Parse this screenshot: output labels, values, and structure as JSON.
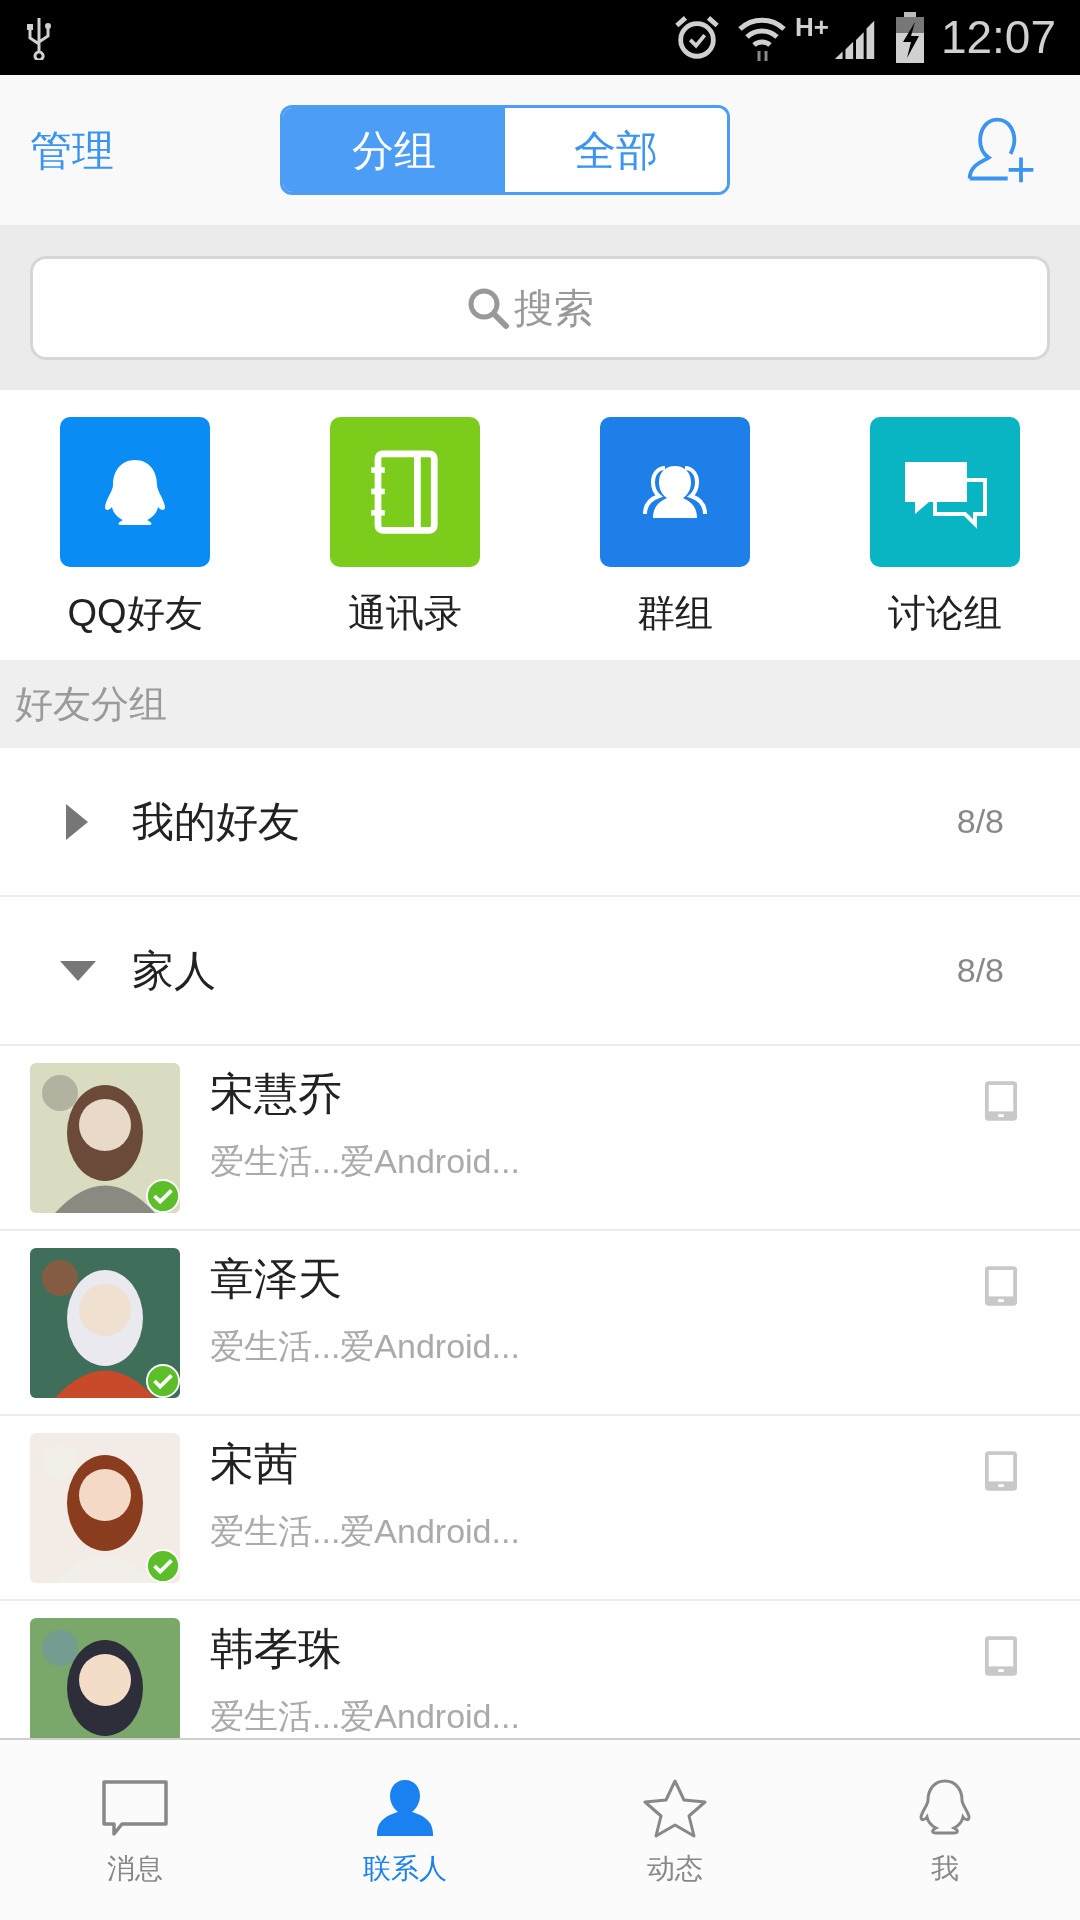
{
  "status_bar": {
    "time": "12:07",
    "network": "H+"
  },
  "header": {
    "manage": "管理",
    "tabs": [
      {
        "label": "分组",
        "selected": true
      },
      {
        "label": "全部",
        "selected": false
      }
    ]
  },
  "search": {
    "placeholder": "搜索"
  },
  "shortcuts": [
    {
      "label": "QQ好友",
      "kind": "penguin",
      "color": "#0a8cf5"
    },
    {
      "label": "通讯录",
      "kind": "notebook",
      "color": "#7ccd1b"
    },
    {
      "label": "群组",
      "kind": "group",
      "color": "#1f7fe8"
    },
    {
      "label": "讨论组",
      "kind": "chat",
      "color": "#0ab5c3"
    }
  ],
  "section_title": "好友分组",
  "groups": [
    {
      "name": "我的好友",
      "count": "8/8",
      "expanded": false
    },
    {
      "name": "家人",
      "count": "8/8",
      "expanded": true
    }
  ],
  "contacts": [
    {
      "name": "宋慧乔",
      "status": "爱生活...爱Android...",
      "online": true
    },
    {
      "name": "章泽天",
      "status": "爱生活...爱Android...",
      "online": true
    },
    {
      "name": "宋茜",
      "status": "爱生活...爱Android...",
      "online": true
    },
    {
      "name": "韩孝珠",
      "status": "爱生活...爱Android...",
      "online": false
    }
  ],
  "bottom_nav": [
    {
      "label": "消息",
      "kind": "message",
      "selected": false
    },
    {
      "label": "联系人",
      "kind": "contacts",
      "selected": true
    },
    {
      "label": "动态",
      "kind": "star",
      "selected": false
    },
    {
      "label": "我",
      "kind": "penguin",
      "selected": false
    }
  ]
}
